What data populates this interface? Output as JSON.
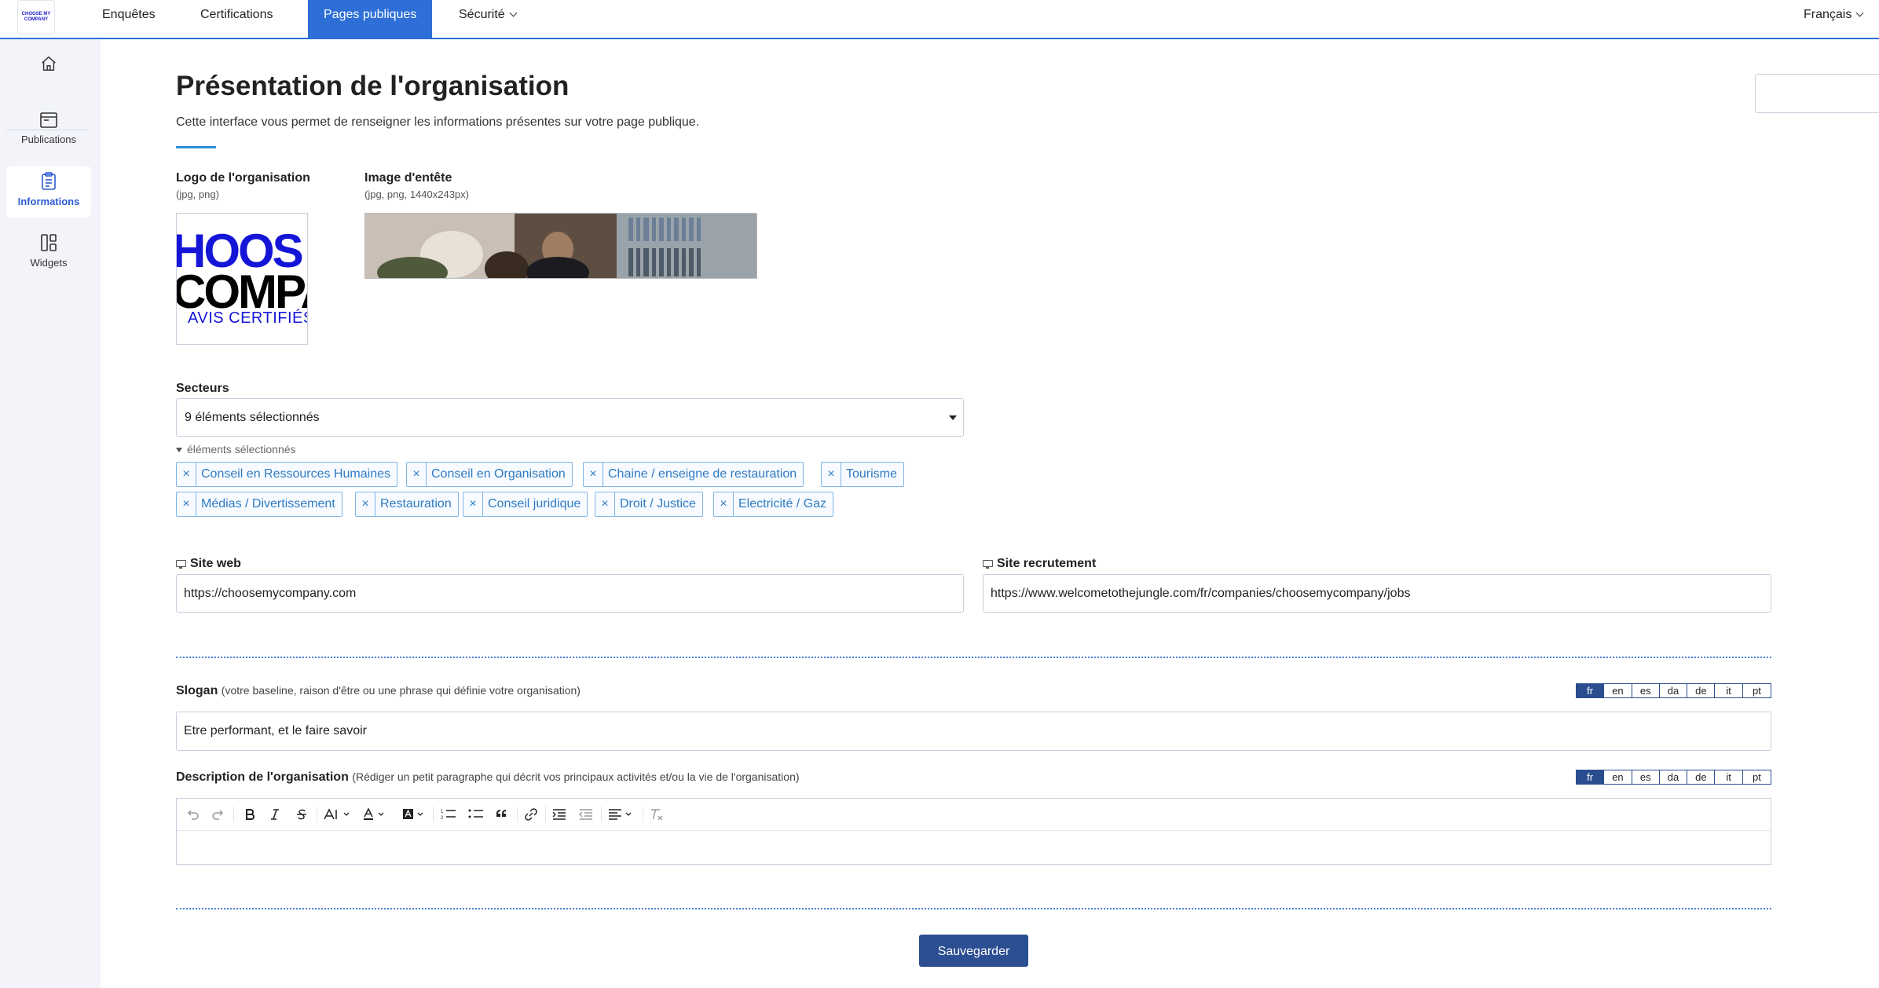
{
  "topnav": {
    "logo_text": "CHOOSE MY COMPANY",
    "items": [
      {
        "label": "Enquêtes"
      },
      {
        "label": "Certifications"
      },
      {
        "label": "Pages publiques"
      },
      {
        "label": "Sécurité"
      }
    ],
    "active_index": 2,
    "language": "Français"
  },
  "sidebar": {
    "items": [
      {
        "label": ""
      },
      {
        "label": "Publications"
      },
      {
        "label": "Informations"
      },
      {
        "label": "Widgets"
      }
    ],
    "active_index": 2
  },
  "page": {
    "title": "Présentation de l'organisation",
    "subtitle": "Cette interface vous permet de renseigner les informations présentes sur votre page publique."
  },
  "logo_section": {
    "label": "Logo de l'organisation",
    "hint": "(jpg, png)",
    "logo_line1": "HOOS",
    "logo_line2": "COMPA",
    "logo_line3": "AVIS CERTIFIÉS"
  },
  "header_image": {
    "label": "Image d'entête",
    "hint": "(jpg, png, 1440x243px)"
  },
  "sectors": {
    "label": "Secteurs",
    "selected_summary": "9 éléments sélectionnés",
    "collapse_label": "éléments sélectionnés",
    "tags": [
      "Conseil en Ressources Humaines",
      "Conseil en Organisation",
      "Chaine / enseigne de restauration",
      "Tourisme",
      "Médias / Divertissement",
      "Restauration",
      "Conseil juridique",
      "Droit / Justice",
      "Electricité / Gaz"
    ],
    "remove_symbol": "×"
  },
  "website": {
    "label": "Site web",
    "value": "https://choosemycompany.com"
  },
  "recruitment": {
    "label": "Site recrutement",
    "value": "https://www.welcometothejungle.com/fr/companies/choosemycompany/jobs"
  },
  "slogan": {
    "label": "Slogan",
    "note": "(votre baseline, raison d'être ou une phrase qui définie votre organisation)",
    "value": "Etre performant, et le faire savoir"
  },
  "description": {
    "label": "Description de l'organisation",
    "note": "(Rédiger un petit paragraphe qui décrit vos principaux activités et/ou la vie de l'organisation)"
  },
  "languages": [
    "fr",
    "en",
    "es",
    "da",
    "de",
    "it",
    "pt"
  ],
  "active_language": "fr",
  "save_label": "Sauvegarder",
  "colors": {
    "primary": "#2d6fd6",
    "save_button": "#2c4e92",
    "tag_text": "#2f7ac4",
    "sidebar_bg": "#f2f4f9"
  }
}
